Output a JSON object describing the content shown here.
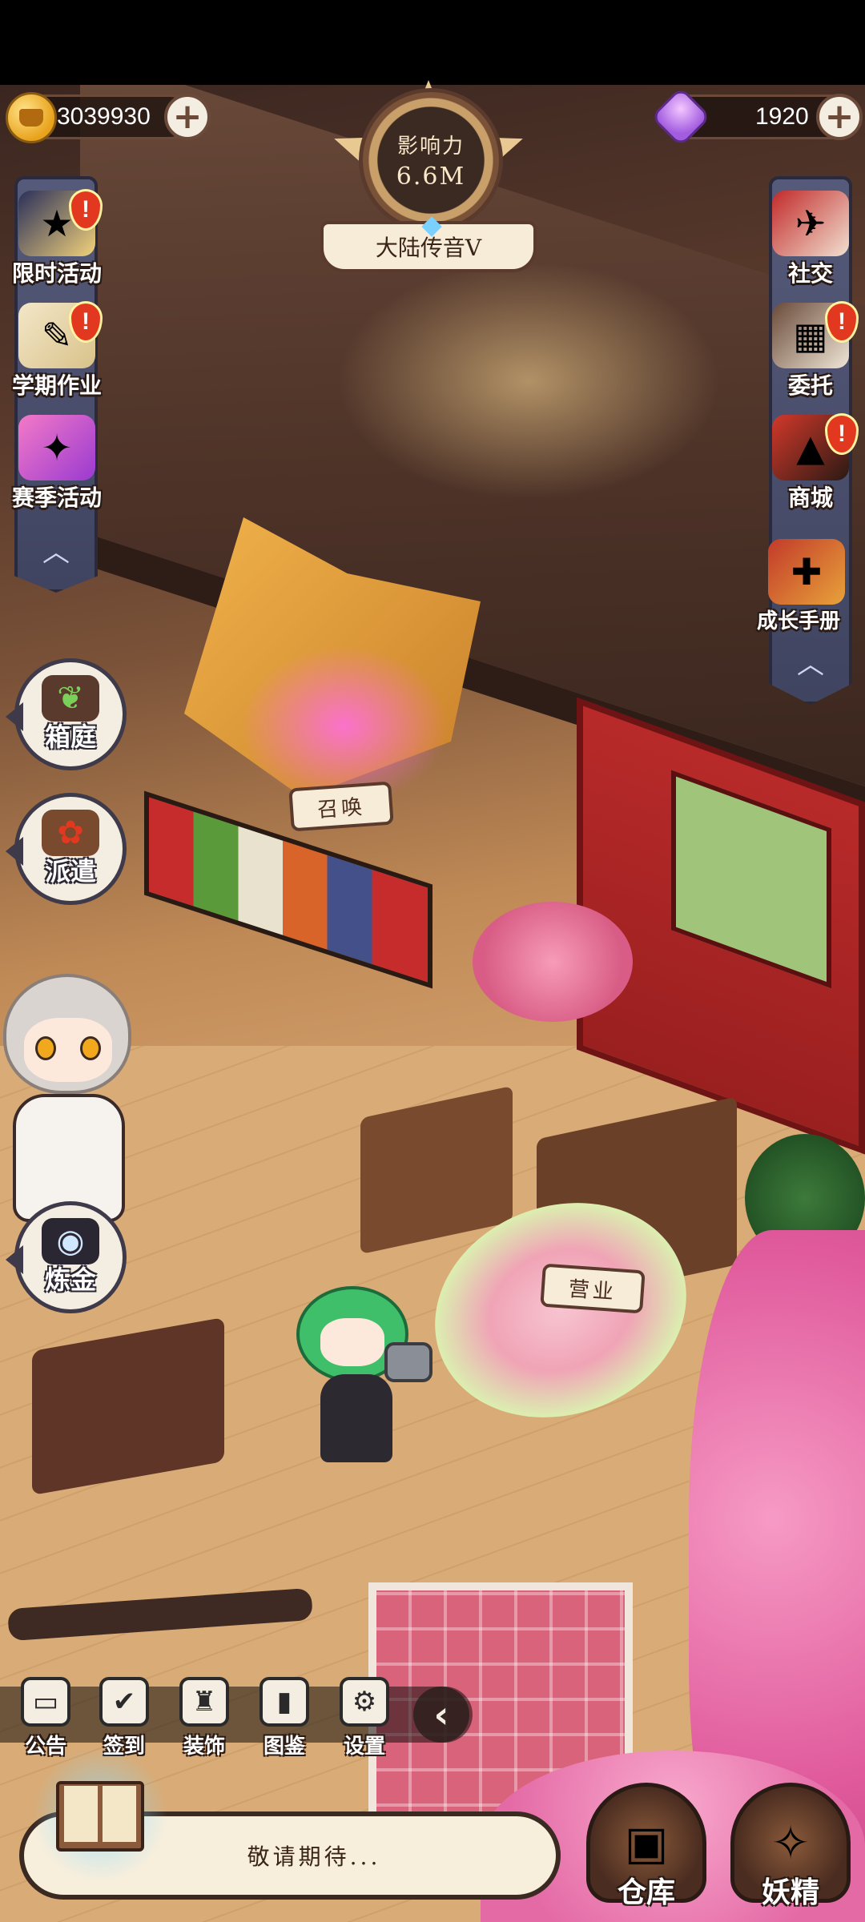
{
  "resources": {
    "coins": "3039930",
    "gems": "1920"
  },
  "influence": {
    "label": "影响力",
    "value": "6.6M",
    "rank": "大陆传音V"
  },
  "left_menu": [
    {
      "label": "限时活动",
      "icon": "calendar-rainbow-icon",
      "alert": "!"
    },
    {
      "label": "学期作业",
      "icon": "scroll-quill-icon",
      "alert": "!"
    },
    {
      "label": "赛季活动",
      "icon": "potion-sparkle-icon"
    }
  ],
  "right_menu": [
    {
      "label": "社交",
      "icon": "birds-icon"
    },
    {
      "label": "委托",
      "icon": "notice-board-icon",
      "alert": "!"
    },
    {
      "label": "商城",
      "icon": "shop-hat-icon",
      "alert": "!"
    },
    {
      "label": "成长手册",
      "icon": "growth-book-icon"
    }
  ],
  "round_buttons": [
    {
      "label": "箱庭",
      "icon": "sprout-box-icon"
    },
    {
      "label": "派遣",
      "icon": "flower-pot-icon"
    },
    {
      "label": "炼金",
      "icon": "cauldron-icon"
    }
  ],
  "scene_labels": {
    "summon": "召唤",
    "business": "营业"
  },
  "toolbar": [
    {
      "label": "公告",
      "icon": "notice-icon"
    },
    {
      "label": "签到",
      "icon": "checkin-icon"
    },
    {
      "label": "装饰",
      "icon": "decor-icon"
    },
    {
      "label": "图鉴",
      "icon": "book-icon"
    },
    {
      "label": "设置",
      "icon": "gear-icon"
    }
  ],
  "chat": {
    "message": "敬请期待..."
  },
  "big_buttons": {
    "warehouse": "仓库",
    "fairy": "妖精"
  }
}
